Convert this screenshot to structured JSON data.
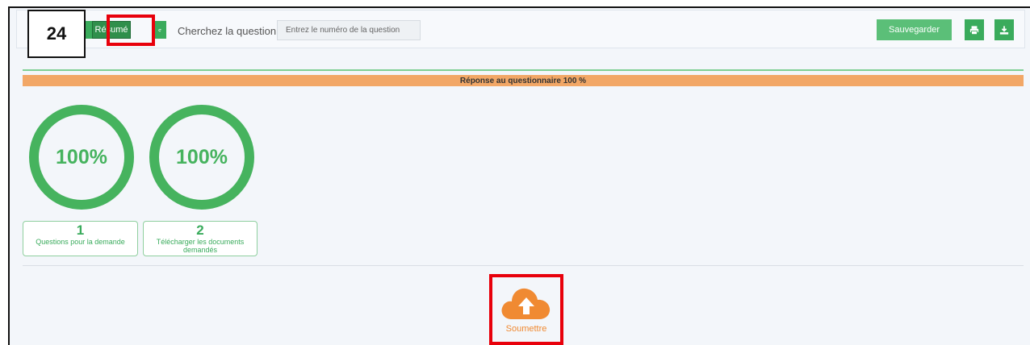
{
  "step_number": "24",
  "toolbar": {
    "summary_label": "Résumé",
    "search_label": "Cherchez la question:",
    "search_placeholder": "Entrez le numéro de la question",
    "save_label": "Sauvegarder"
  },
  "progress": {
    "text": "Réponse au questionnaire 100 %",
    "value_percent": 100
  },
  "sections": [
    {
      "percent": "100%",
      "number": "1",
      "label": "Questions pour la demande"
    },
    {
      "percent": "100%",
      "number": "2",
      "label": "Télécharger les documents demandés"
    }
  ],
  "submit_label": "Soumettre",
  "icons": [
    "refresh-icon",
    "print-icon",
    "download-icon",
    "cloud-upload-icon"
  ],
  "colors": {
    "green": "#3aab5c",
    "orange": "#f2a766",
    "highlight_red": "#e8000b"
  }
}
